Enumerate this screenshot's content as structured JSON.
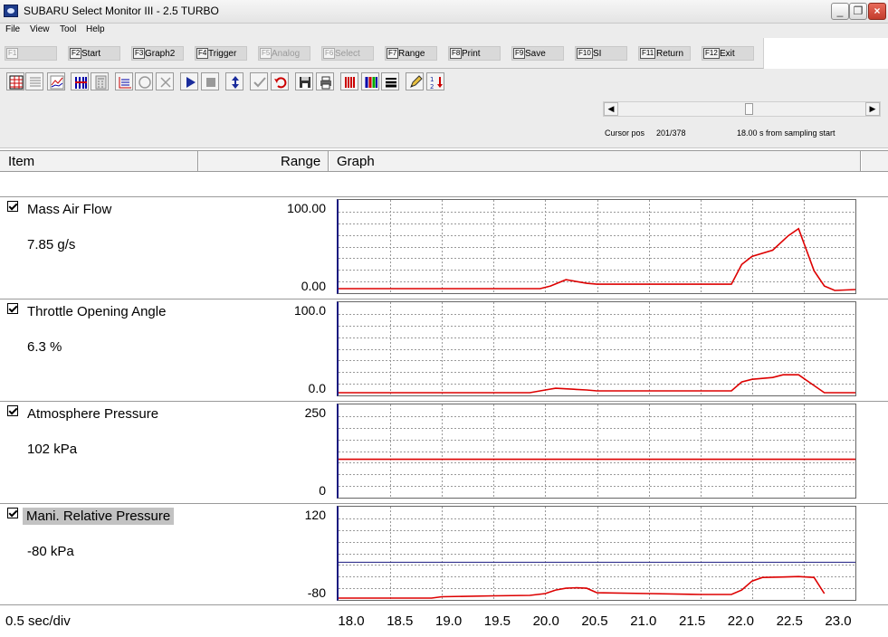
{
  "window": {
    "title": "SUBARU Select Monitor III - 2.5 TURBO"
  },
  "menu": [
    "File",
    "View",
    "Tool",
    "Help"
  ],
  "fkeys": [
    {
      "key": "F1",
      "label": "",
      "enabled": false
    },
    {
      "key": "F2",
      "label": "Start",
      "enabled": true
    },
    {
      "key": "F3",
      "label": "Graph2",
      "enabled": true
    },
    {
      "key": "F4",
      "label": "Trigger",
      "enabled": true
    },
    {
      "key": "F5",
      "label": "Analog",
      "enabled": false
    },
    {
      "key": "F6",
      "label": "Select",
      "enabled": false
    },
    {
      "key": "F7",
      "label": "Range",
      "enabled": true
    },
    {
      "key": "F8",
      "label": "Print",
      "enabled": true
    },
    {
      "key": "F9",
      "label": "Save",
      "enabled": true
    },
    {
      "key": "F10",
      "label": "SI",
      "enabled": true
    },
    {
      "key": "F11",
      "label": "Return",
      "enabled": true
    },
    {
      "key": "F12",
      "label": "Exit",
      "enabled": true
    }
  ],
  "toolbar_icons": [
    "table-view-icon",
    "list-view-icon",
    "graph-view-icon",
    "bar-graph-icon",
    "calculator-icon",
    "trigger-graph-icon",
    "circle-marker-icon",
    "x-marker-icon",
    "play-icon",
    "stop-icon",
    "vertical-arrows-icon",
    "checkmark-icon",
    "undo-icon",
    "save-disk-icon",
    "printer-icon",
    "red-bars-icon",
    "color-bars-icon",
    "line-width-icon",
    "pencil-icon",
    "sort-icon"
  ],
  "cursor": {
    "label": "Cursor pos",
    "value": "201/378",
    "time_text": "18.00 s from sampling start",
    "position_fraction": 0.53
  },
  "header": {
    "item": "Item",
    "range": "Range",
    "graph": "Graph"
  },
  "channels": [
    {
      "name": "Mass Air Flow",
      "value": "7.85 g/s",
      "range_max": "100.00",
      "range_min": "0.00",
      "selected": false,
      "color": "#dd0000",
      "ymin": 0,
      "ymax": 100,
      "x": [
        18.0,
        18.5,
        19.0,
        19.5,
        19.95,
        20.05,
        20.2,
        20.4,
        20.5,
        21.0,
        21.5,
        21.8,
        21.9,
        22.0,
        22.2,
        22.35,
        22.45,
        22.6,
        22.7,
        22.8,
        23.0
      ],
      "y": [
        3,
        3,
        3,
        3,
        3,
        6,
        13,
        9,
        8,
        8,
        8,
        8,
        30,
        39,
        46,
        62,
        70,
        23,
        6,
        1,
        2
      ]
    },
    {
      "name": "Throttle Opening Angle",
      "value": "6.3 %",
      "range_max": "100.0",
      "range_min": "0.0",
      "selected": false,
      "color": "#dd0000",
      "ymin": 0,
      "ymax": 100,
      "x": [
        18.0,
        18.5,
        19.0,
        19.5,
        19.85,
        20.0,
        20.1,
        20.4,
        20.5,
        21.0,
        21.5,
        21.8,
        21.9,
        22.0,
        22.2,
        22.3,
        22.45,
        22.55,
        22.7,
        22.8,
        23.0
      ],
      "y": [
        1,
        1,
        1,
        1,
        1,
        4,
        6,
        4,
        3,
        3,
        3,
        3,
        13,
        16,
        18,
        21,
        21,
        13,
        1,
        1,
        1
      ]
    },
    {
      "name": "Atmosphere Pressure",
      "value": "102 kPa",
      "range_max": "250",
      "range_min": "0",
      "selected": false,
      "color": "#dd0000",
      "ymin": 0,
      "ymax": 250,
      "x": [
        18.0,
        23.0
      ],
      "y": [
        102,
        102
      ]
    },
    {
      "name": "Mani. Relative Pressure",
      "value": "-80 kPa",
      "range_max": "120",
      "range_min": "-80",
      "selected": true,
      "color": "#dd0000",
      "ymin": -80,
      "ymax": 120,
      "ref_value": 0,
      "ref_color": "#1a1a80",
      "x": [
        18.0,
        18.5,
        18.9,
        19.0,
        19.5,
        19.85,
        20.0,
        20.1,
        20.2,
        20.3,
        20.4,
        20.5,
        21.0,
        21.5,
        21.8,
        21.9,
        22.0,
        22.1,
        22.3,
        22.45,
        22.6,
        22.7
      ],
      "y": [
        -80,
        -80,
        -80,
        -77,
        -75,
        -74,
        -70,
        -62,
        -58,
        -57,
        -58,
        -68,
        -70,
        -72,
        -72,
        -62,
        -42,
        -34,
        -33,
        -32,
        -34,
        -70
      ]
    }
  ],
  "x_axis": {
    "min": 18.0,
    "max": 23.0,
    "ticks": [
      "18.0",
      "18.5",
      "19.0",
      "19.5",
      "20.0",
      "20.5",
      "21.0",
      "21.5",
      "22.0",
      "22.5",
      "23.0"
    ]
  },
  "time_per_div": "0.5 sec/div"
}
